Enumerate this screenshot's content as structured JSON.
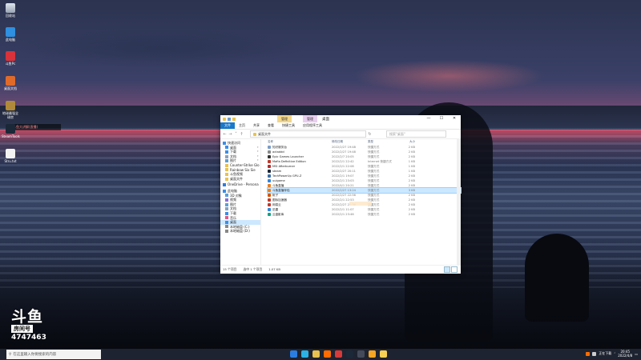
{
  "desktop": {
    "icons": [
      {
        "label": "回收站",
        "icon": "recycle-bin-icon"
      },
      {
        "label": "此电脑",
        "icon": "computer-icon"
      },
      {
        "label": "斗鱼Pc",
        "icon": "douyu-icon"
      },
      {
        "label": "桌面文档",
        "icon": "document-icon"
      },
      {
        "label": "地球最强全球房",
        "icon": "game-icon"
      },
      {
        "label": "SteamTools",
        "icon": "steam-icon"
      },
      {
        "label": "Stru.txt",
        "icon": "text-file-icon"
      }
    ],
    "notice": "斗鱼大讲解(直播)"
  },
  "explorer": {
    "title": "桌面",
    "context_tabs": [
      "管理",
      "管理"
    ],
    "ribbon_tabs": [
      "文件",
      "主页",
      "共享",
      "查看",
      "快捷工具",
      "应用程序工具"
    ],
    "address": "桌面文件",
    "search_placeholder": "搜索\"桌面\"",
    "nav": [
      {
        "label": "快速访问",
        "type": "head",
        "icon": "star-icon"
      },
      {
        "label": "桌面",
        "pinned": true,
        "icon": "desktop-icon"
      },
      {
        "label": "下载",
        "pinned": true,
        "icon": "download-icon"
      },
      {
        "label": "文档",
        "pinned": true,
        "icon": "document-icon"
      },
      {
        "label": "图片",
        "pinned": true,
        "icon": "picture-icon"
      },
      {
        "label": "Counter-Strike Glo",
        "icon": "folder-icon"
      },
      {
        "label": "Rainbow Six Sie",
        "icon": "folder-icon"
      },
      {
        "label": "斗鱼视频",
        "icon": "folder-icon"
      },
      {
        "label": "桌面文件",
        "icon": "folder-icon"
      },
      {
        "label": "",
        "type": "gap"
      },
      {
        "label": "OneDrive - Persona",
        "type": "head",
        "icon": "cloud-icon"
      },
      {
        "label": "",
        "type": "gap"
      },
      {
        "label": "此电脑",
        "type": "head",
        "icon": "computer-icon"
      },
      {
        "label": "3D 对象",
        "icon": "cube-icon"
      },
      {
        "label": "视频",
        "icon": "video-icon"
      },
      {
        "label": "图片",
        "icon": "picture-icon"
      },
      {
        "label": "文档",
        "icon": "document-icon"
      },
      {
        "label": "下载",
        "icon": "download-icon"
      },
      {
        "label": "音乐",
        "icon": "music-icon"
      },
      {
        "label": "桌面",
        "selected": true,
        "icon": "desktop-icon"
      },
      {
        "label": "本地磁盘 (C:)",
        "icon": "disk-icon"
      },
      {
        "label": "本地磁盘 (D:)",
        "icon": "disk-icon"
      }
    ],
    "columns": {
      "name": "名称",
      "date": "修改日期",
      "type": "类型",
      "size": "大小"
    },
    "files": [
      {
        "name": "知识服务台",
        "date": "2022/2/27 19:48",
        "type": "快捷方式",
        "size": "2 KB",
        "color": "#7a9cc6"
      },
      {
        "name": "actaddd",
        "date": "2022/2/27 19:48",
        "type": "快捷方式",
        "size": "2 KB",
        "color": "#8a8a8a"
      },
      {
        "name": "Epic Games Launcher",
        "date": "2022/2/7 20:05",
        "type": "快捷方式",
        "size": "2 KB",
        "color": "#333333"
      },
      {
        "name": "Mafia Definitive Edition",
        "date": "2022/2/1 22:42",
        "type": "Internet 快捷方式",
        "size": "1 KB",
        "color": "#c0392b"
      },
      {
        "name": "MSI Afterburner",
        "date": "2022/2/1 22:08",
        "type": "快捷方式",
        "size": "1 KB",
        "color": "#b52a2a"
      },
      {
        "name": "steam",
        "date": "2022/2/27 20:11",
        "type": "快捷方式",
        "size": "1 KB",
        "color": "#1b2838"
      },
      {
        "name": "TechPowerUp GPU-Z",
        "date": "2022/2/1 19:07",
        "type": "快捷方式",
        "size": "2 KB",
        "color": "#3a6ea5"
      },
      {
        "name": "uuigame",
        "date": "2022/2/1 23:03",
        "type": "快捷方式",
        "size": "2 KB",
        "color": "#2e86de"
      },
      {
        "name": "斗鱼直播",
        "date": "2022/4/1 20:21",
        "type": "快捷方式",
        "size": "2 KB",
        "color": "#e67e22"
      },
      {
        "name": "斗鱼直播伴侣",
        "date": "2022/2/27 13:24",
        "type": "快捷方式",
        "size": "3 KB",
        "color": "#e67e22",
        "selected": true
      },
      {
        "name": "帐子",
        "date": "2022/2/27 22:56",
        "type": "快捷方式",
        "size": "2 KB",
        "color": "#d35400"
      },
      {
        "name": "图标加速器",
        "date": "2022/2/1 22:53",
        "type": "快捷方式",
        "size": "2 KB",
        "color": "#c0392b"
      },
      {
        "name": "网易云",
        "date": "2022/2/27 22:36",
        "type": "快捷方式",
        "size": "2 KB",
        "color": "#c0392b"
      },
      {
        "name": "迅雷",
        "date": "2022/2/1 11:07",
        "type": "快捷方式",
        "size": "2 KB",
        "color": "#2e86de"
      },
      {
        "name": "云盘影库",
        "date": "2022/2/1 23:46",
        "type": "快捷方式",
        "size": "2 KB",
        "color": "#16a085"
      }
    ],
    "status": {
      "count": "15 个项目",
      "selected": "选中 1 个项目",
      "size": "1.07 KB"
    }
  },
  "douyu": {
    "logo": "斗鱼",
    "room_label": "房间号",
    "room_number": "4747463"
  },
  "taskbar": {
    "search_placeholder": "在这里输入你要搜索的内容",
    "apps": [
      {
        "name": "windows-icon",
        "color": "#2a7de1"
      },
      {
        "name": "edge-icon",
        "color": "#2bb1e6"
      },
      {
        "name": "explorer-icon",
        "color": "#e9c24f"
      },
      {
        "name": "douyu-icon",
        "color": "#ff6b00"
      },
      {
        "name": "red-app-icon",
        "color": "#d63a3a"
      },
      {
        "name": "steam-icon",
        "color": "#1b2838"
      },
      {
        "name": "record-icon",
        "color": "#444a5a"
      },
      {
        "name": "orange-app-icon",
        "color": "#f5a623"
      },
      {
        "name": "yellow-app-icon",
        "color": "#f7d154"
      }
    ],
    "tray_text": "正在下载",
    "time": "20:45",
    "date": "2022/4/8"
  }
}
